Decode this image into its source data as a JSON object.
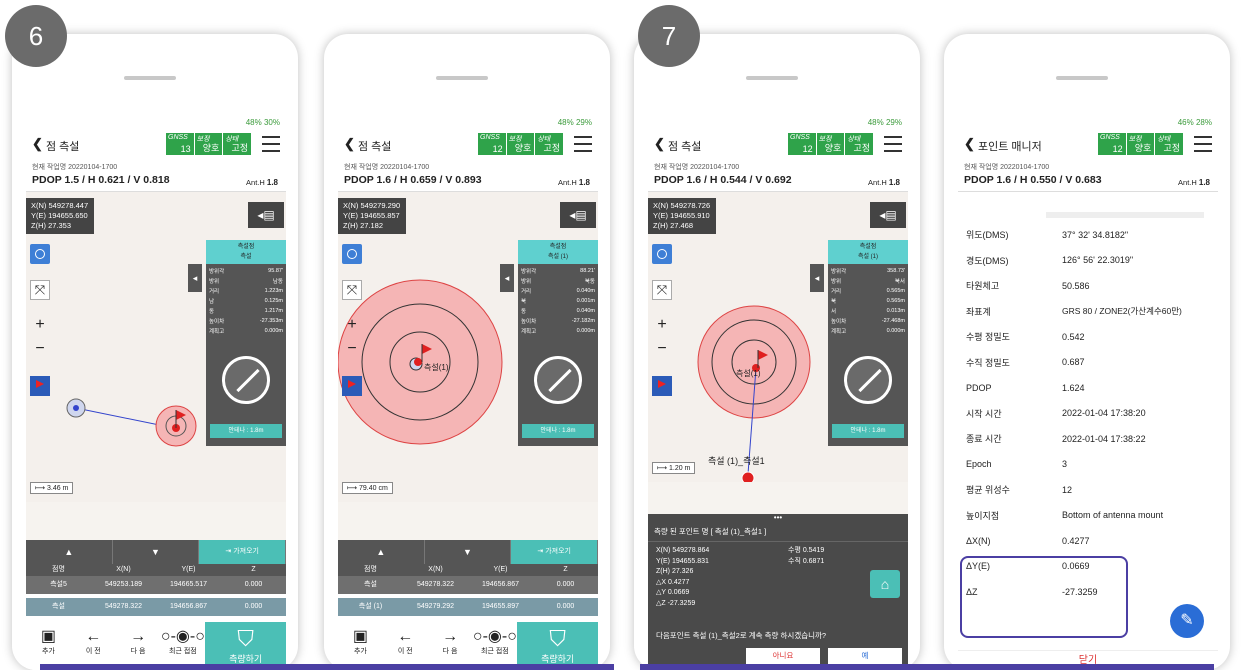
{
  "badges": {
    "step6": "6",
    "step7": "7"
  },
  "screens": [
    {
      "battery": "48%",
      "phone": "30%",
      "title": "점 측설",
      "gnss": {
        "c1": "GNSS",
        "c2": "보정",
        "c3": "상태",
        "sat": "13",
        "corr": "양호",
        "state": "고정"
      },
      "job": "현재 작업명 20220104-1700",
      "pdop": "PDOP 1.5 / H 0.621 / V 0.818",
      "anth_label": "Ant.H",
      "anth": "1.8",
      "coord": [
        "X(N) 549278.447",
        "Y(E) 194655.650",
        "Z(H) 27.353"
      ],
      "panel_head": [
        "측설점",
        "측설"
      ],
      "panel_rows": [
        [
          "방위각",
          "95.87'"
        ],
        [
          "방위",
          "남동"
        ],
        [
          "거리",
          "1.223m"
        ],
        [
          "남",
          "0.125m"
        ],
        [
          "동",
          "1.217m"
        ],
        [
          "높이차",
          "-27.353m"
        ],
        [
          "계획고",
          "0.000m"
        ]
      ],
      "antenna": "안테나 : 1.8m",
      "scale": "3.46 m",
      "import": "가져오기",
      "table_head": [
        "점명",
        "X(N)",
        "Y(E)",
        "Z"
      ],
      "rows": [
        [
          "측설5",
          "549253.189",
          "194665.517",
          "0.000"
        ],
        [
          "측설",
          "549278.322",
          "194656.867",
          "0.000"
        ]
      ],
      "actions": [
        "추가",
        "이 전",
        "다 음",
        "최근 접점"
      ],
      "measure": "측량하기"
    },
    {
      "battery": "48%",
      "phone": "29%",
      "title": "점 측설",
      "gnss": {
        "c1": "GNSS",
        "c2": "보정",
        "c3": "상태",
        "sat": "12",
        "corr": "양호",
        "state": "고정"
      },
      "job": "현재 작업명 20220104-1700",
      "pdop": "PDOP 1.6 / H 0.659 / V 0.893",
      "anth_label": "Ant.H",
      "anth": "1.8",
      "coord": [
        "X(N) 549279.290",
        "Y(E) 194655.857",
        "Z(H) 27.182"
      ],
      "panel_head": [
        "측설점",
        "측설 (1)"
      ],
      "panel_rows": [
        [
          "방위각",
          "88.21'"
        ],
        [
          "방위",
          "북동"
        ],
        [
          "거리",
          "0.040m"
        ],
        [
          "북",
          "0.001m"
        ],
        [
          "동",
          "0.040m"
        ],
        [
          "높이차",
          "-27.182m"
        ],
        [
          "계획고",
          "0.000m"
        ]
      ],
      "antenna": "안테나 : 1.8m",
      "scale": "79.40 cm",
      "point_label": "측설(1)",
      "import": "가져오기",
      "table_head": [
        "점명",
        "X(N)",
        "Y(E)",
        "Z"
      ],
      "rows": [
        [
          "측설",
          "549278.322",
          "194656.867",
          "0.000"
        ],
        [
          "측설 (1)",
          "549279.292",
          "194655.897",
          "0.000"
        ]
      ],
      "actions": [
        "추가",
        "이 전",
        "다 음",
        "최근 접점"
      ],
      "measure": "측량하기"
    },
    {
      "battery": "48%",
      "phone": "29%",
      "title": "점 측설",
      "gnss": {
        "c1": "GNSS",
        "c2": "보정",
        "c3": "상태",
        "sat": "12",
        "corr": "양호",
        "state": "고정"
      },
      "job": "현재 작업명 20220104-1700",
      "pdop": "PDOP 1.6 / H 0.544 / V 0.692",
      "anth_label": "Ant.H",
      "anth": "1.8",
      "coord": [
        "X(N) 549278.726",
        "Y(E) 194655.910",
        "Z(H) 27.468"
      ],
      "panel_head": [
        "측설점",
        "측설 (1)"
      ],
      "panel_rows": [
        [
          "방위각",
          "358.73'"
        ],
        [
          "방위",
          "북서"
        ],
        [
          "거리",
          "0.565m"
        ],
        [
          "북",
          "0.565m"
        ],
        [
          "서",
          "0.013m"
        ],
        [
          "높이차",
          "-27.468m"
        ],
        [
          "계획고",
          "0.000m"
        ]
      ],
      "antenna": "안테나 : 1.8m",
      "scale": "1.20 m",
      "point_label": "측설(1)",
      "point2_label": "측설 (1)_측설1",
      "dialog": {
        "title": "측량 된 포인트 명 [ 측설 (1)_측설1 ]",
        "left": [
          "X(N) 549278.864",
          "Y(E) 194655.831",
          "Z(H) 27.326",
          "△X 0.4277",
          "△Y 0.0669",
          "△Z -27.3259"
        ],
        "right": [
          "수평 0.5419",
          "수직 0.6871"
        ],
        "question": "다음포인트 측설 (1)_측설2로 계속 측량 하시겠습니까?",
        "no": "아니요",
        "yes": "예"
      }
    },
    {
      "battery": "46%",
      "phone": "28%",
      "title": "포인트 매니저",
      "gnss": {
        "c1": "GNSS",
        "c2": "보정",
        "c3": "상태",
        "sat": "12",
        "corr": "양호",
        "state": "고정"
      },
      "job": "현재 작업명 20220104-1700",
      "pdop": "PDOP 1.6 / H 0.550 / V 0.683",
      "anth_label": "Ant.H",
      "anth": "1.8",
      "fields": [
        [
          "위도(DMS)",
          "37° 32' 34.8182\""
        ],
        [
          "경도(DMS)",
          "126° 56' 22.3019\""
        ],
        [
          "타원체고",
          "50.586"
        ],
        [
          "좌표계",
          "GRS 80 / ZONE2(가산계수60만)"
        ],
        [
          "수평 정밀도",
          "0.542"
        ],
        [
          "수직 정밀도",
          "0.687"
        ],
        [
          "PDOP",
          "1.624"
        ],
        [
          "시작 시간",
          "2022-01-04 17:38:20"
        ],
        [
          "종료 시간",
          "2022-01-04 17:38:22"
        ],
        [
          "Epoch",
          "3"
        ],
        [
          "평균 위성수",
          "12"
        ],
        [
          "높이지점",
          "Bottom of antenna mount"
        ],
        [
          "ΔX(N)",
          "0.4277"
        ],
        [
          "ΔY(E)",
          "0.0669"
        ],
        [
          "ΔZ",
          "-27.3259"
        ]
      ],
      "close": "닫기"
    }
  ],
  "colors": {
    "accent": "#4bbfb6",
    "highlight": "#4b3fa3",
    "gnss": "#2fa34a"
  }
}
